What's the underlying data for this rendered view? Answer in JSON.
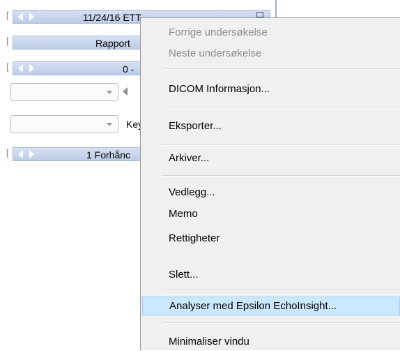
{
  "left_panel": {
    "rows": [
      {
        "type": "navbar",
        "text": "11/24/16 ETT"
      },
      {
        "type": "plain",
        "text": "Rapport"
      },
      {
        "type": "navbar",
        "text": "0 -"
      },
      {
        "type": "navbar",
        "text": "1 Forhånc"
      }
    ],
    "key_label": "Key"
  },
  "menu": {
    "items": [
      {
        "label": "Forrige undersøkelse",
        "disabled": true
      },
      {
        "label": "Neste undersøkelse",
        "disabled": true
      },
      {
        "label": "DICOM Informasjon...",
        "disabled": false
      },
      {
        "label": "Eksporter...",
        "disabled": false
      },
      {
        "label": "Arkiver...",
        "disabled": false
      },
      {
        "label": "Vedlegg...",
        "disabled": false
      },
      {
        "label": "Memo",
        "disabled": false
      },
      {
        "label": "Rettigheter",
        "disabled": false
      },
      {
        "label": "Slett...",
        "disabled": false
      },
      {
        "label": "Analyser med Epsilon EchoInsight...",
        "disabled": false,
        "highlighted": true
      },
      {
        "label": "Minimaliser vindu",
        "disabled": false
      }
    ]
  },
  "colors": {
    "navbar": "#bccbe6",
    "highlight": "#cce8ff",
    "menu_bg": "#f0f0f0"
  }
}
